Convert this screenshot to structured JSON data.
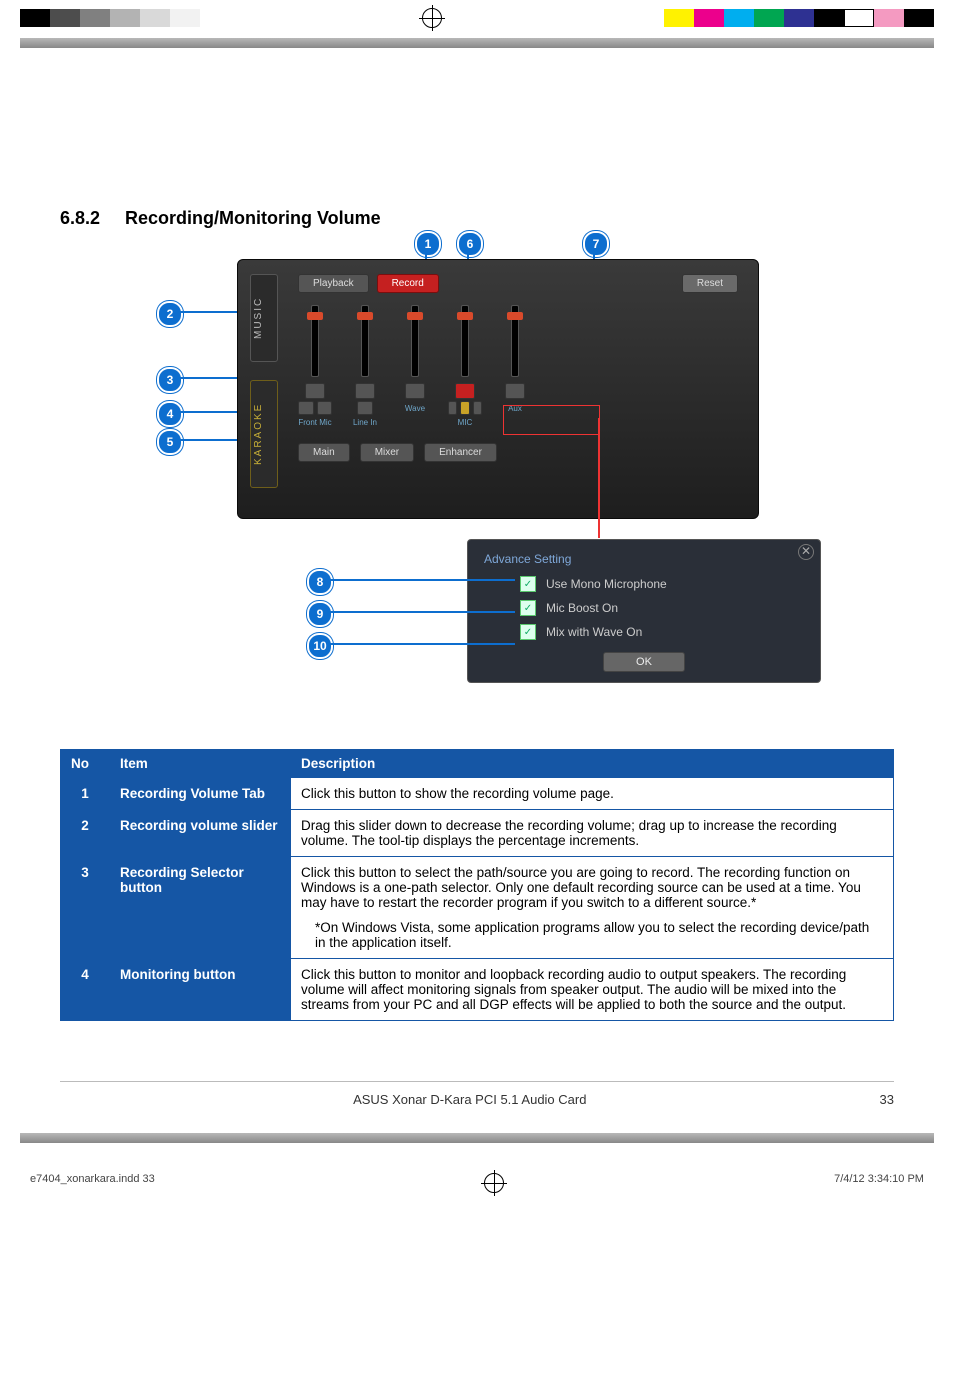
{
  "print_marks": {
    "left_swatches": [
      "#000000",
      "#4d4d4d",
      "#808080",
      "#b3b3b3",
      "#d9d9d9",
      "#f2f2f2"
    ],
    "right_swatches": [
      "#fff200",
      "#ec008c",
      "#00aeef",
      "#00a651",
      "#2e3192",
      "#000000",
      "#ffffff",
      "#f49ac1",
      "#000000"
    ]
  },
  "section": {
    "number": "6.8.2",
    "title": "Recording/Monitoring Volume"
  },
  "mixer": {
    "side_tabs": {
      "music": "MUSIC",
      "karaoke": "KARAOKE"
    },
    "top_tabs": {
      "playback": "Playback",
      "record": "Record",
      "reset": "Reset"
    },
    "channels": [
      {
        "label": "Front Mic"
      },
      {
        "label": "Line In"
      },
      {
        "label": "Wave"
      },
      {
        "label": "MIC"
      },
      {
        "label": "Aux"
      }
    ],
    "bottom_tabs": {
      "main": "Main",
      "mixer": "Mixer",
      "enhancer": "Enhancer"
    }
  },
  "popup": {
    "title": "Advance Setting",
    "opts": {
      "mono": "Use Mono Microphone",
      "boost": "Mic Boost On",
      "mix": "Mix with Wave On"
    },
    "ok": "OK"
  },
  "callouts": {
    "c1": "1",
    "c2": "2",
    "c3": "3",
    "c4": "4",
    "c5": "5",
    "c6": "6",
    "c7": "7",
    "c8": "8",
    "c9": "9",
    "c10": "10"
  },
  "table": {
    "headers": {
      "no": "No",
      "item": "Item",
      "desc": "Description"
    },
    "rows": [
      {
        "no": "1",
        "item": "Recording Volume Tab",
        "desc": "Click this button to show the recording volume page."
      },
      {
        "no": "2",
        "item": "Recording volume slider",
        "desc": "Drag this slider down to decrease the recording volume; drag up to increase the recording volume. The tool-tip displays the percentage increments."
      },
      {
        "no": "3",
        "item": "Recording Selector button",
        "desc": "Click this button to select the path/source you are going to record. The recording function on Windows is a one-path selector. Only one default recording source can be used at a time. You may have to restart the recorder program if you switch to a different source.*",
        "note": "*On Windows Vista, some application programs allow you to select the recording device/path in the application itself."
      },
      {
        "no": "4",
        "item": "Monitoring button",
        "desc": "Click this button to monitor and loopback recording audio to output speakers.  The recording volume will affect monitoring signals from speaker output.  The audio will be mixed into the streams from your PC and all DGP effects will be applied to both the source and the output."
      }
    ]
  },
  "footer": {
    "product": "ASUS Xonar D-Kara PCI 5.1 Audio Card",
    "page": "33"
  },
  "slug": {
    "file": "e7404_xonarkara.indd   33",
    "datetime": "7/4/12   3:34:10 PM"
  }
}
